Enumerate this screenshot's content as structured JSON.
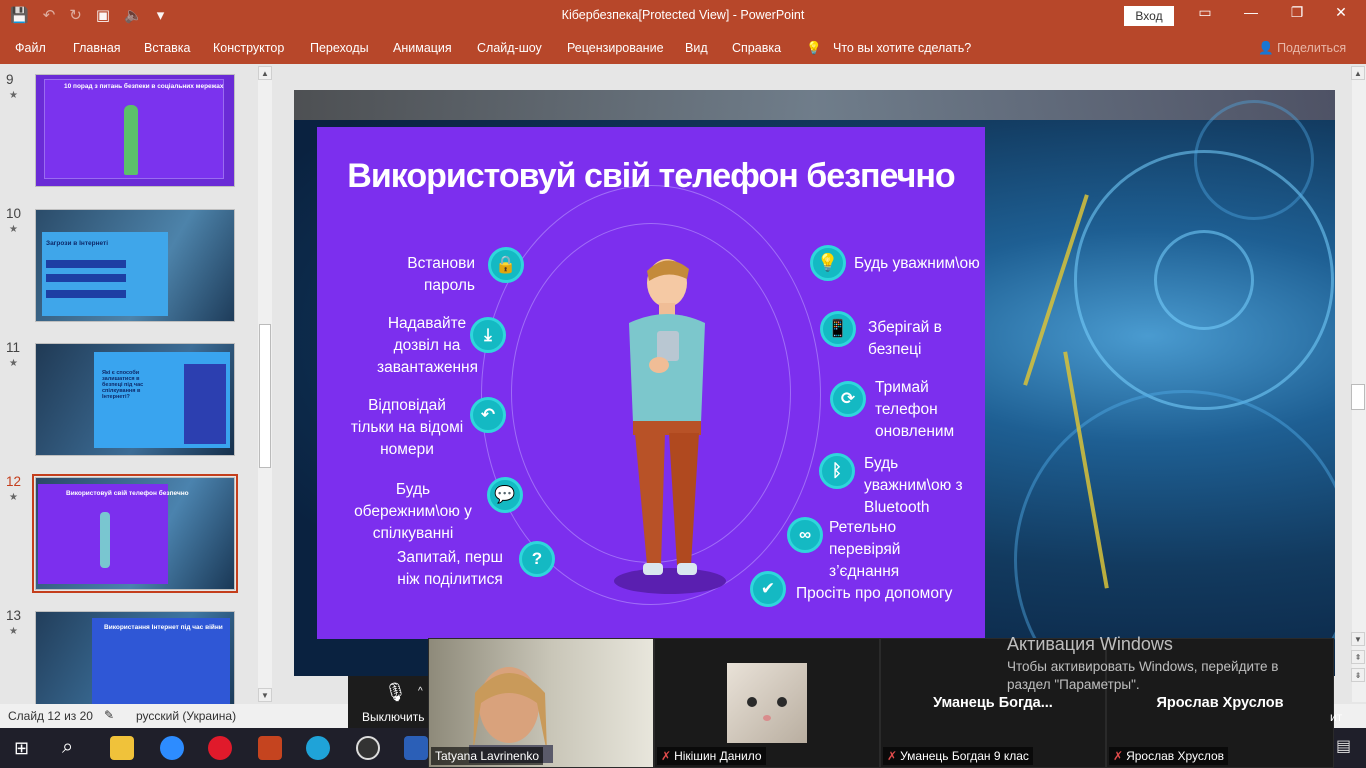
{
  "window": {
    "title": "Кібербезпека[Protected View]  -  PowerPoint",
    "signin": "Вход"
  },
  "ribbon": {
    "tabs": [
      "Файл",
      "Главная",
      "Вставка",
      "Конструктор",
      "Переходы",
      "Анимация",
      "Слайд-шоу",
      "Рецензирование",
      "Вид",
      "Справка"
    ],
    "tell_me": "Что вы хотите сделать?",
    "share": "Поделиться"
  },
  "thumbnails": [
    {
      "number": "9",
      "star": "★",
      "title": "10 порад з питань безпеки в соціальних мережах"
    },
    {
      "number": "10",
      "star": "★",
      "title": "Загрози в Інтернеті"
    },
    {
      "number": "11",
      "star": "★",
      "title": "Які є способи залишатися в безпеці під час спілкування в Інтернеті?"
    },
    {
      "number": "12",
      "star": "★",
      "title": "Використовуй свій телефон безпечно"
    },
    {
      "number": "13",
      "star": "★",
      "title": "Використання Інтернет під час війни"
    }
  ],
  "slide": {
    "title": "Використовуй свій телефон безпечно",
    "left_items": [
      {
        "icon": "lock-icon",
        "glyph": "🔒",
        "text": "Встанови пароль"
      },
      {
        "icon": "download-icon",
        "glyph": "⤓",
        "text": "Надавайте дозвіл на завантаження"
      },
      {
        "icon": "call-back-icon",
        "glyph": "↶",
        "text": "Відповідай тільки на відомі номери"
      },
      {
        "icon": "chat-icon",
        "glyph": "💬",
        "text": "Будь обережним\\ою у спілкуванні"
      },
      {
        "icon": "question-icon",
        "glyph": "?",
        "text": "Запитай, перш ніж поділитися"
      }
    ],
    "right_items": [
      {
        "icon": "idea-icon",
        "glyph": "💡",
        "text": "Будь уважним\\ою"
      },
      {
        "icon": "phone-signal-icon",
        "glyph": "📱",
        "text": "Зберігай в безпеці"
      },
      {
        "icon": "phone-update-icon",
        "glyph": "⟳",
        "text": "Тримай телефон оновленим"
      },
      {
        "icon": "bluetooth-icon",
        "glyph": "ᛒ",
        "text": "Будь уважним\\ою з Bluetooth"
      },
      {
        "icon": "link-icon",
        "glyph": "∞",
        "text": "Ретельно перевіряй з’єднання"
      },
      {
        "icon": "shield-check-icon",
        "glyph": "✔",
        "text": "Просіть про допомогу"
      }
    ]
  },
  "status": {
    "slide_info": "Слайд 12 из 20",
    "language": "русский (Украина)"
  },
  "call": {
    "mute_label": "Выключить",
    "stop_label": "ит",
    "tiles": [
      {
        "name": "Tatyana Lavrinenko",
        "muted": false,
        "big": ""
      },
      {
        "name": "Нікішин Данило",
        "muted": true,
        "big": ""
      },
      {
        "name": "Уманець Богдан 9 клас",
        "muted": true,
        "big": "Уманець  Богда..."
      },
      {
        "name": "Ярослав Хруслов",
        "muted": true,
        "big": "Ярослав Хруслов"
      }
    ]
  },
  "activation": {
    "title": "Активация Windows",
    "line1": "Чтобы активировать Windows, перейдите в",
    "line2": "раздел \"Параметры\"."
  }
}
